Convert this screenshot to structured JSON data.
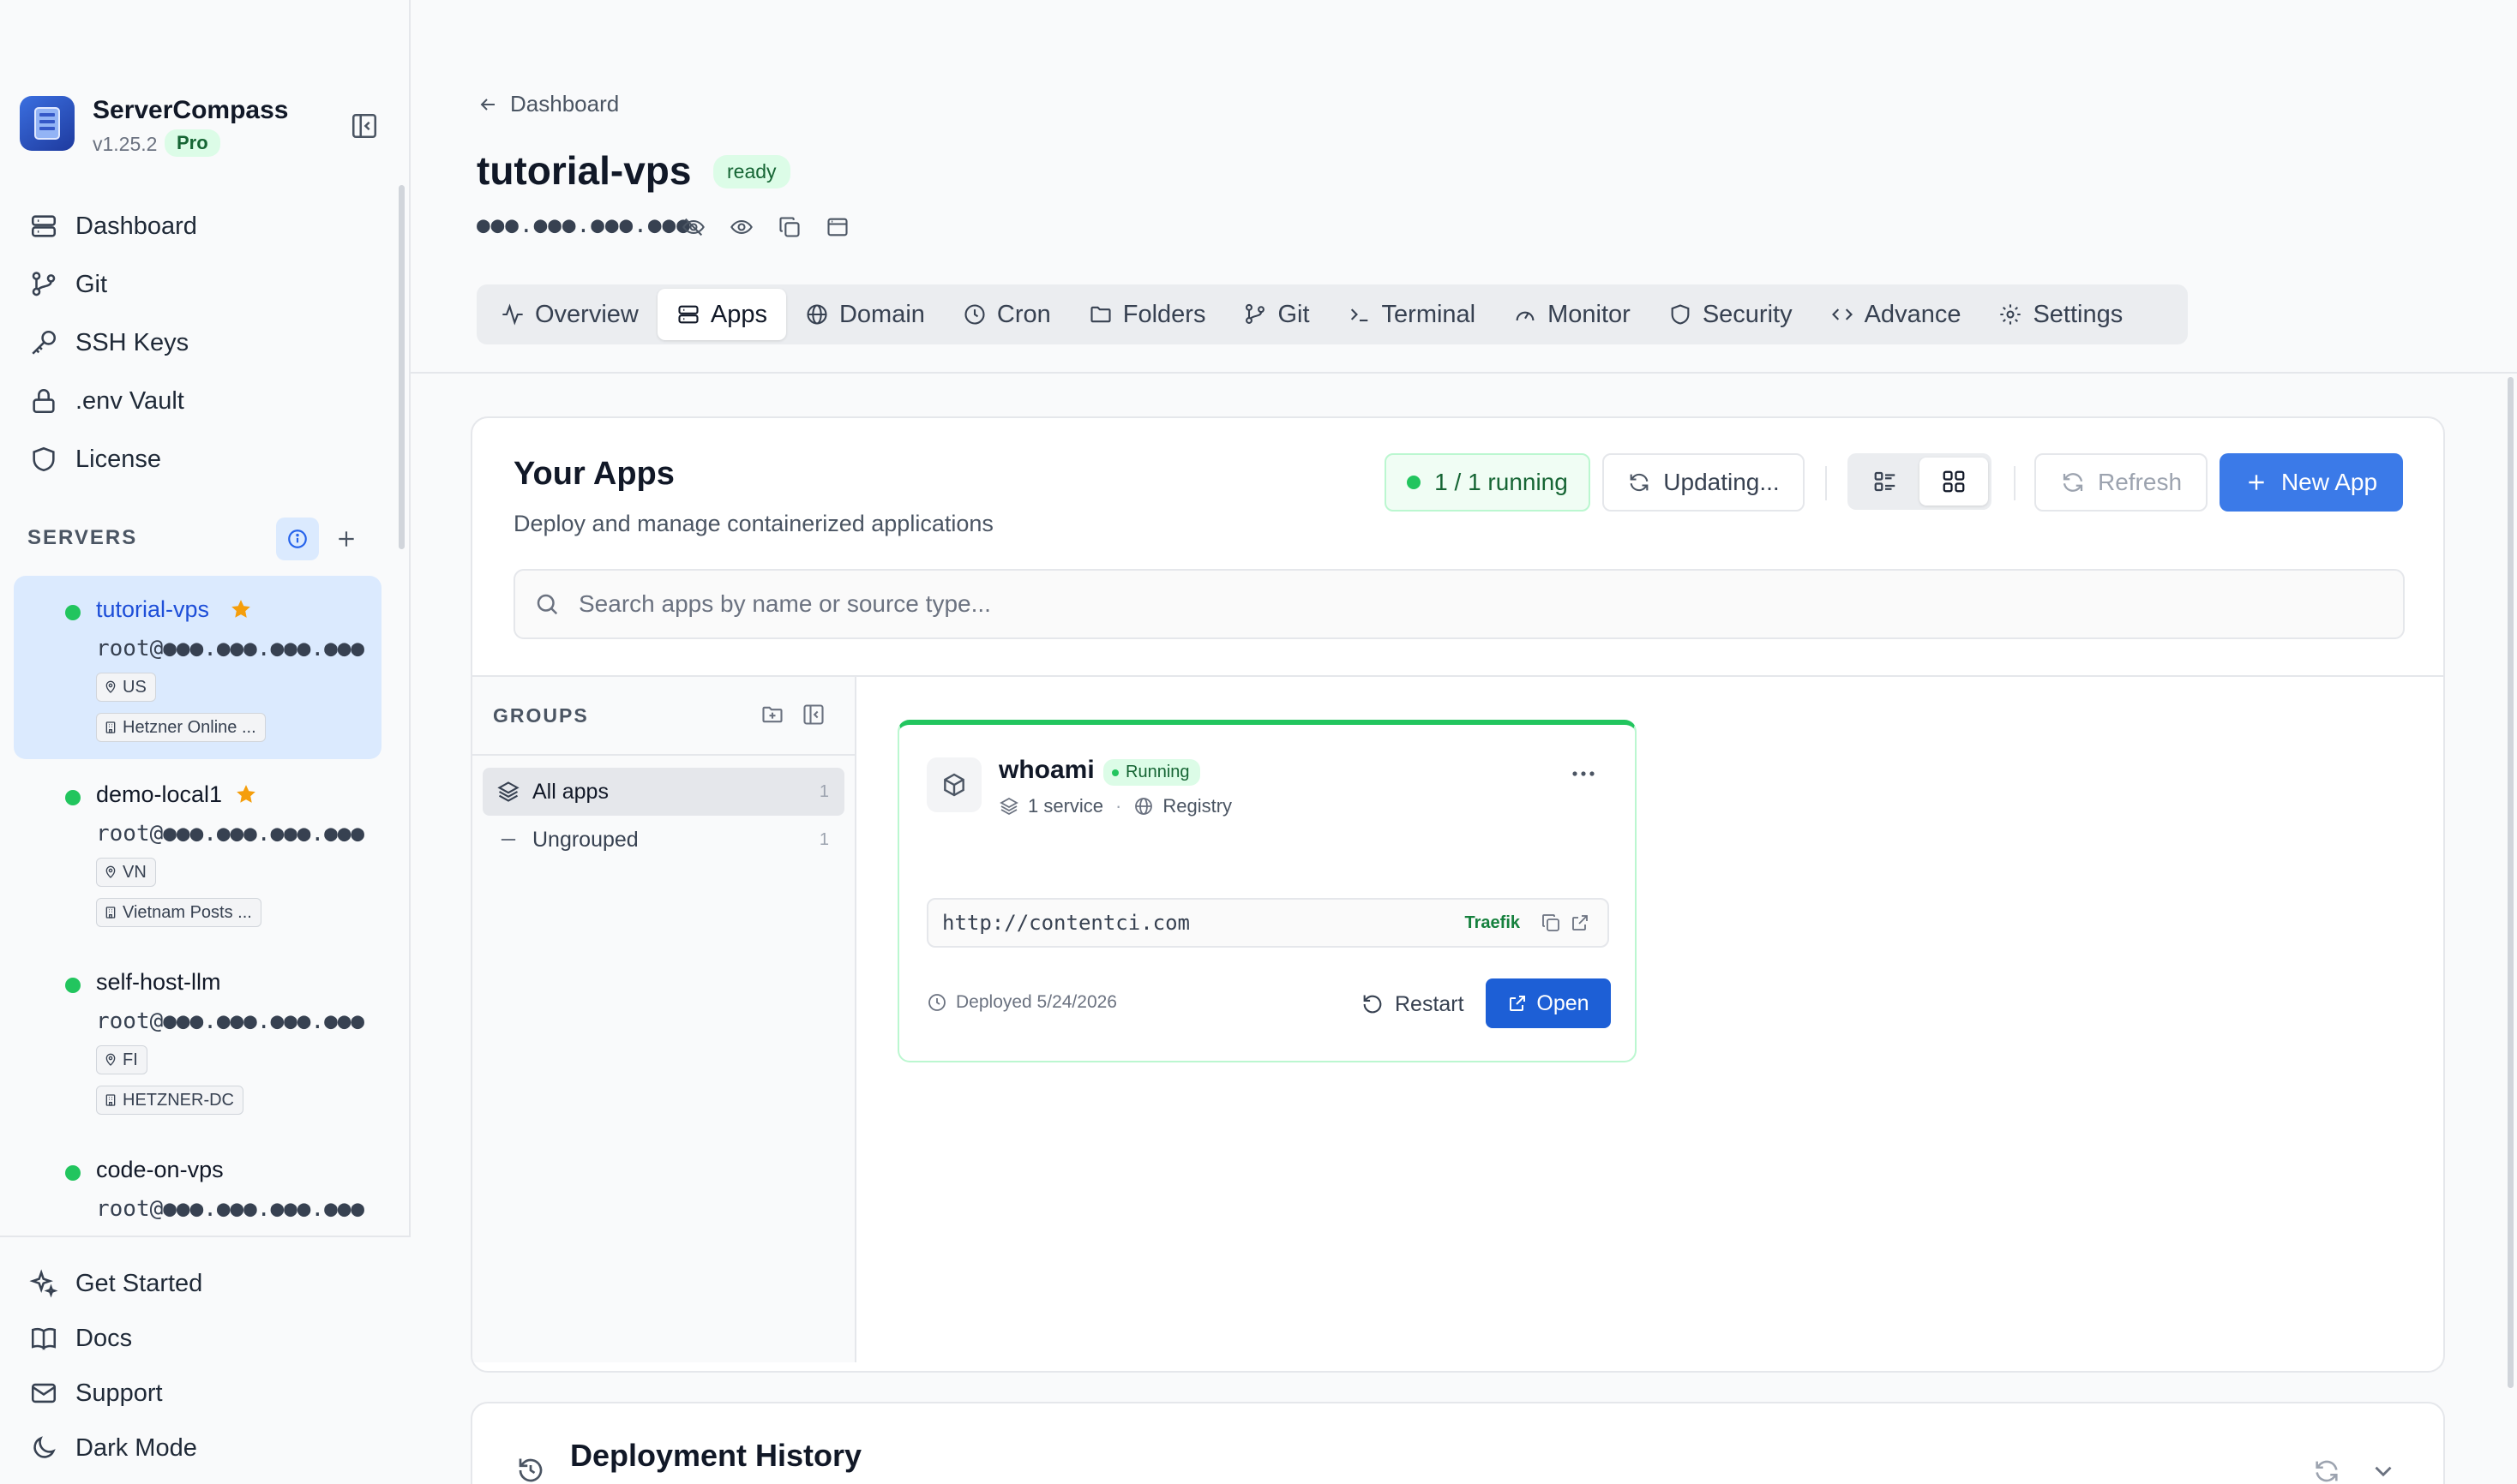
{
  "brand": {
    "name": "ServerCompass",
    "version": "v1.25.2",
    "plan": "Pro"
  },
  "nav": [
    {
      "label": "Dashboard",
      "icon": "server-stack-icon"
    },
    {
      "label": "Git",
      "icon": "git-branch-icon"
    },
    {
      "label": "SSH Keys",
      "icon": "key-icon"
    },
    {
      "label": ".env Vault",
      "icon": "lock-icon"
    },
    {
      "label": "License",
      "icon": "shield-icon"
    }
  ],
  "servers_heading": "SERVERS",
  "servers": [
    {
      "name": "tutorial-vps",
      "ssh": "root@●●●.●●●.●●●.●●●",
      "country": "US",
      "provider": "Hetzner Online ...",
      "favorite": true,
      "active": true
    },
    {
      "name": "demo-local1",
      "ssh": "root@●●●.●●●.●●●.●●●",
      "country": "VN",
      "provider": "Vietnam Posts ...",
      "favorite": true,
      "active": false
    },
    {
      "name": "self-host-llm",
      "ssh": "root@●●●.●●●.●●●.●●●",
      "country": "FI",
      "provider": "HETZNER-DC",
      "favorite": false,
      "active": false
    },
    {
      "name": "code-on-vps",
      "ssh": "root@●●●.●●●.●●●.●●●",
      "favorite": false,
      "active": false
    }
  ],
  "bottom_nav": [
    {
      "label": "Get Started",
      "icon": "sparkles-icon"
    },
    {
      "label": "Docs",
      "icon": "book-icon"
    },
    {
      "label": "Support",
      "icon": "mail-icon"
    },
    {
      "label": "Dark Mode",
      "icon": "moon-icon"
    }
  ],
  "header": {
    "back_label": "Dashboard",
    "server_name": "tutorial-vps",
    "status": "ready",
    "ip_masked": "●●●.●●●.●●●.●●●"
  },
  "tabs": [
    {
      "label": "Overview",
      "icon": "activity-icon"
    },
    {
      "label": "Apps",
      "icon": "server-stack-icon",
      "active": true
    },
    {
      "label": "Domain",
      "icon": "globe-icon"
    },
    {
      "label": "Cron",
      "icon": "clock-icon"
    },
    {
      "label": "Folders",
      "icon": "folder-icon"
    },
    {
      "label": "Git",
      "icon": "git-branch-icon"
    },
    {
      "label": "Terminal",
      "icon": "terminal-icon"
    },
    {
      "label": "Monitor",
      "icon": "gauge-icon"
    },
    {
      "label": "Security",
      "icon": "shield-icon"
    },
    {
      "label": "Advance",
      "icon": "code-icon"
    },
    {
      "label": "Settings",
      "icon": "gear-icon"
    }
  ],
  "apps_panel": {
    "title": "Your Apps",
    "subtitle": "Deploy and manage containerized applications",
    "running_status": "1 / 1 running",
    "updating_label": "Updating...",
    "refresh_label": "Refresh",
    "new_app_label": "New App",
    "view_mode": "grid",
    "search_placeholder": "Search apps by name or source type..."
  },
  "groups": {
    "heading": "GROUPS",
    "items": [
      {
        "label": "All apps",
        "count": "1",
        "active": true
      },
      {
        "label": "Ungrouped",
        "count": "1",
        "active": false
      }
    ]
  },
  "app": {
    "name": "whoami",
    "status": "Running",
    "services": "1 service",
    "source": "Registry",
    "url": "http://contentci.com",
    "proxy": "Traefik",
    "deployed": "Deployed 5/24/2026",
    "restart_label": "Restart",
    "open_label": "Open"
  },
  "history": {
    "title": "Deployment History"
  },
  "colors": {
    "accent": "#3b7ae8",
    "success": "#22c55e",
    "active_bg": "#dbeafe",
    "star": "#f59e0b"
  }
}
